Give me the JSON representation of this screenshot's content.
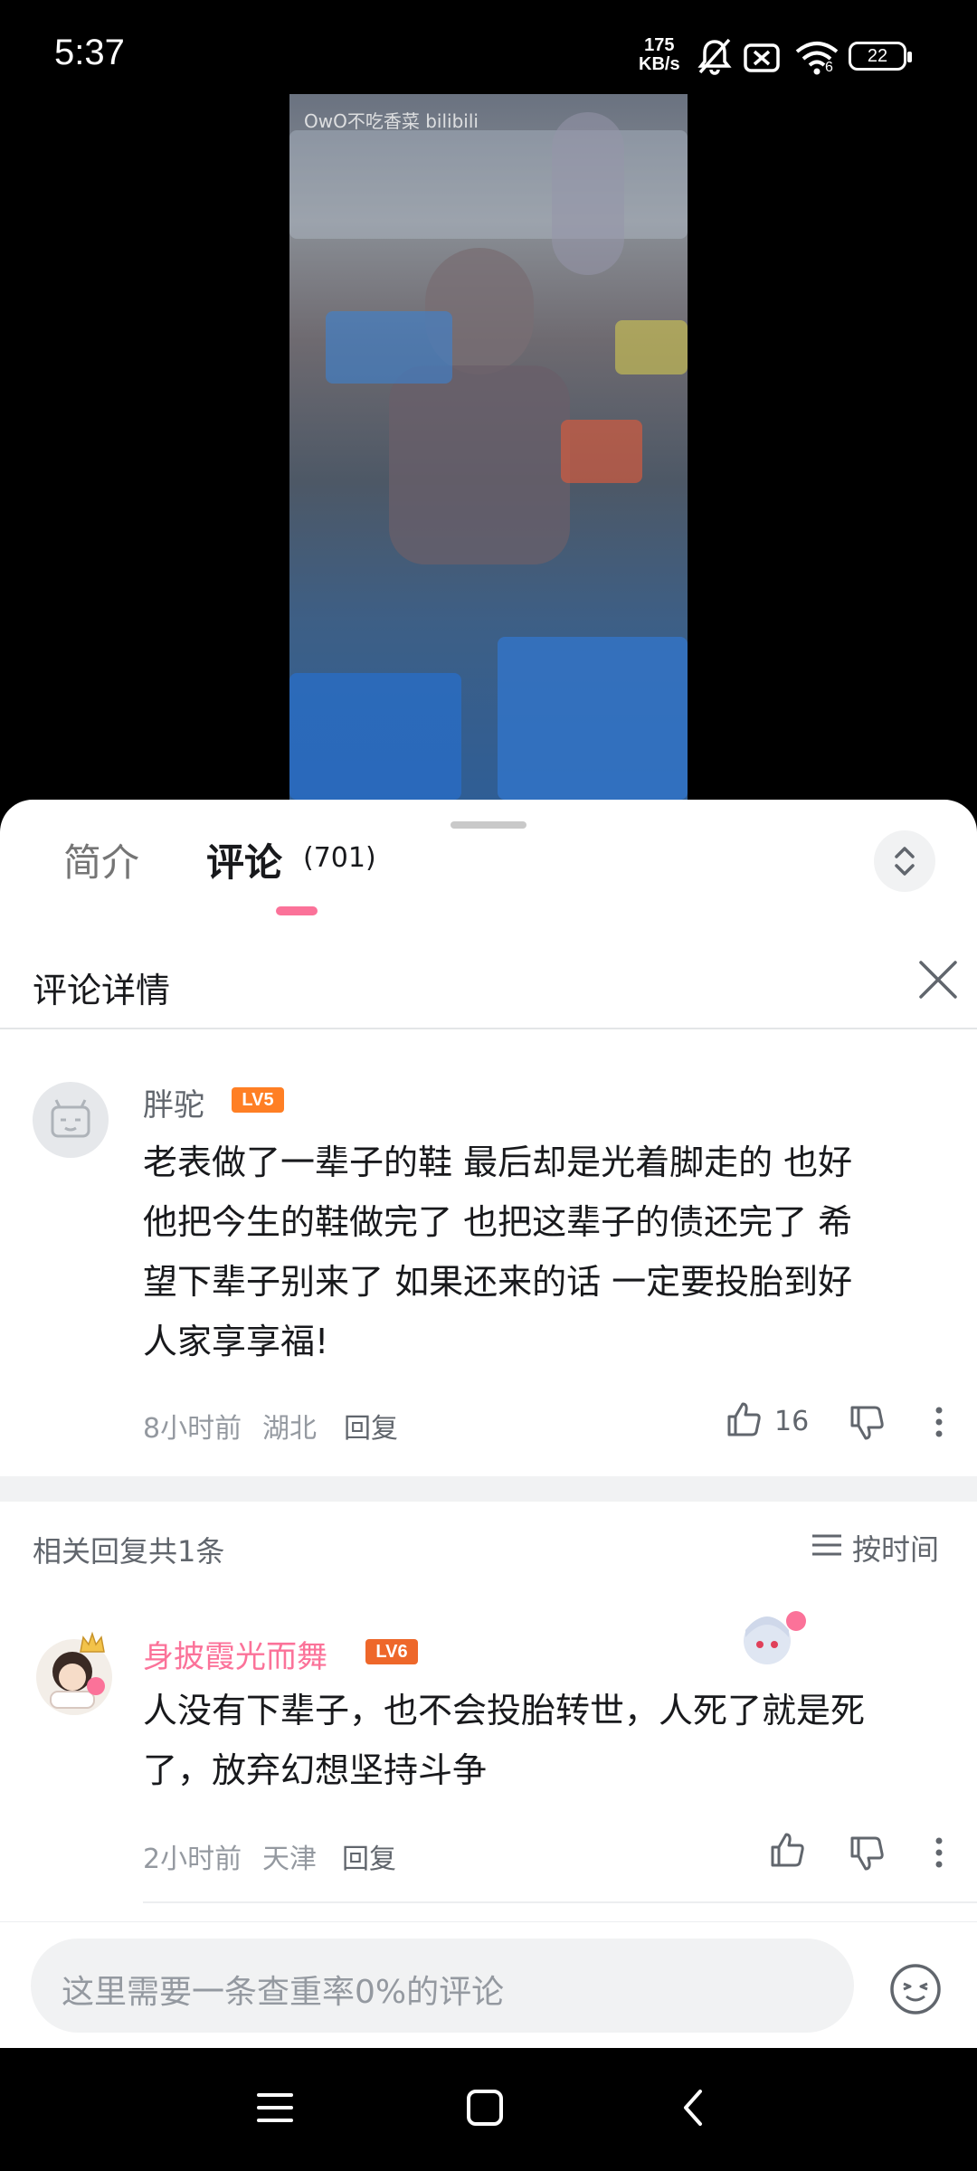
{
  "status_bar": {
    "time": "5:37",
    "net_speed_value": "175",
    "net_speed_unit": "KB/s",
    "battery": "22",
    "wifi_badge": "6"
  },
  "video": {
    "watermark": "OwO不吃香菜 bilibili"
  },
  "tabs": {
    "intro_label": "简介",
    "comments_label": "评论",
    "comments_count": "(701)"
  },
  "detail": {
    "title": "评论详情"
  },
  "main_comment": {
    "username": "胖驼",
    "level": "LV5",
    "text_lines": [
      "老表做了一辈子的鞋 最后却是光着脚走的 也好",
      "他把今生的鞋做完了 也把这辈子的债还完了 希",
      "望下辈子别来了 如果还来的话 一定要投胎到好",
      "人家享享福!"
    ],
    "time": "8小时前",
    "location": "湖北",
    "reply_label": "回复",
    "likes": "16"
  },
  "replies_header": {
    "title": "相关回复共1条",
    "sort_label": "按时间"
  },
  "reply": {
    "username": "身披霞光而舞",
    "level": "LV6",
    "text_lines": [
      "人没有下辈子，也不会投胎转世，人死了就是死",
      "了，放弃幻想坚持斗争"
    ],
    "time": "2小时前",
    "location": "天津",
    "reply_label": "回复"
  },
  "input": {
    "placeholder": "这里需要一条查重率0%的评论"
  },
  "colors": {
    "accent_pink": "#fb7299",
    "lv5": "#ff7f24",
    "lv6": "#ee672a",
    "vip_name": "#fb7299"
  }
}
